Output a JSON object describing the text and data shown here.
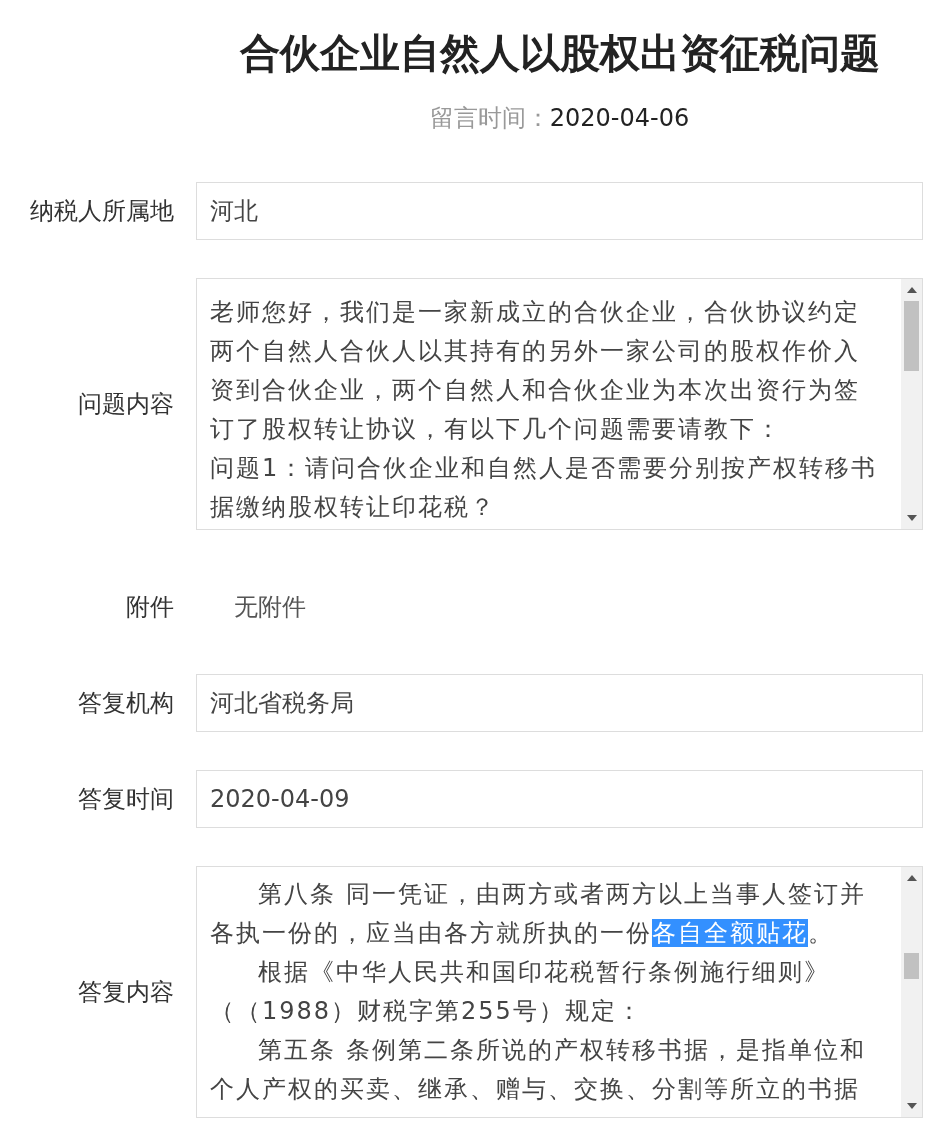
{
  "title": "合伙企业自然人以股权出资征税问题",
  "message_time": {
    "label": "留言时间：",
    "value": "2020-04-06"
  },
  "fields": [
    {
      "kind": "input",
      "label": "纳税人所属地",
      "value": "河北"
    },
    {
      "kind": "textarea",
      "label": "问题内容",
      "paragraphs": [
        {
          "indent": false,
          "segments": [
            {
              "text": "老师您好，我们是一家新成立的合伙企业，合伙协议约定两个自然人合伙人以其持有的另外一家公司的股权作价入资到合伙企业，两个自然人和合伙企业为本次出资行为签订了股权转让协议，有以下几个问题需要请教下：",
              "selected": false
            }
          ]
        },
        {
          "indent": false,
          "segments": [
            {
              "text": "问题1：请问合伙企业和自然人是否需要分别按产权转移书据缴纳股权转让印花税？",
              "selected": false
            }
          ]
        }
      ]
    },
    {
      "kind": "plain",
      "label": "附件",
      "value": "无附件"
    },
    {
      "kind": "input",
      "label": "答复机构",
      "value": "河北省税务局"
    },
    {
      "kind": "input",
      "label": "答复时间",
      "value": "2020-04-09"
    },
    {
      "kind": "textarea",
      "label": "答复内容",
      "paragraphs": [
        {
          "indent": true,
          "segments": [
            {
              "text": "第八条 同一凭证，由两方或者两方以上当事人签订并各执一份的，应当由各方就所执的一份",
              "selected": false
            },
            {
              "text": "各自全额贴花",
              "selected": true
            },
            {
              "text": "。",
              "selected": false
            }
          ]
        },
        {
          "indent": true,
          "segments": [
            {
              "text": "根据《中华人民共和国印花税暂行条例施行细则》（（1988）财税字第255号）规定：",
              "selected": false
            }
          ]
        },
        {
          "indent": true,
          "segments": [
            {
              "text": "第五条 条例第二条所说的产权转移书据，是指单位和个人产权的买卖、继承、赠与、交换、分割等所立的书据",
              "selected": false
            }
          ]
        }
      ]
    }
  ]
}
